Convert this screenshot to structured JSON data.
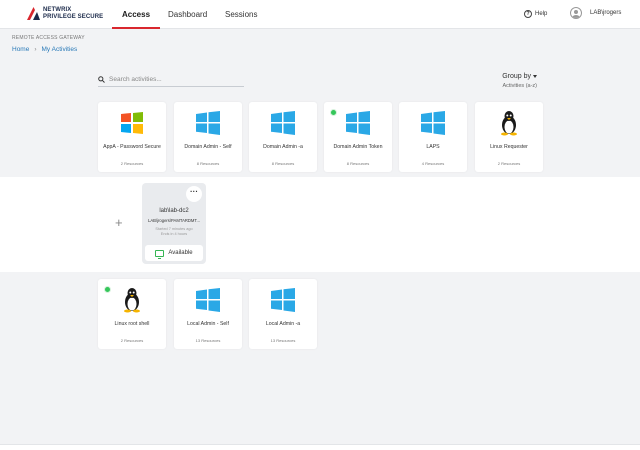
{
  "header": {
    "brand_line1": "NETWRIX",
    "brand_line2": "PRIVILEGE SECURE",
    "tabs": [
      {
        "label": "Access",
        "active": true
      },
      {
        "label": "Dashboard",
        "active": false
      },
      {
        "label": "Sessions",
        "active": false
      }
    ],
    "help_label": "Help",
    "user_label": "LAB\\jrogers"
  },
  "page": {
    "subtitle": "REMOTE ACCESS GATEWAY",
    "breadcrumb": [
      "Home",
      "My Activities"
    ],
    "search_placeholder": "Search activities...",
    "group_by_label": "Group by",
    "group_by_value": "Activities (a-z)"
  },
  "activities_row1": [
    {
      "name": "AppA - Password Secure",
      "resources": "2 Resources",
      "icon": "windows-color-icon",
      "active": false
    },
    {
      "name": "Domain Admin - Self",
      "resources": "8 Resources",
      "icon": "windows-icon",
      "active": false
    },
    {
      "name": "Domain Admin -a",
      "resources": "8 Resources",
      "icon": "windows-icon",
      "active": false
    },
    {
      "name": "Domain Admin Token",
      "resources": "8 Resources",
      "icon": "windows-icon",
      "active": true
    },
    {
      "name": "LAPS",
      "resources": "4 Resources",
      "icon": "windows-icon",
      "active": false
    },
    {
      "name": "Linux Requester",
      "resources": "2 Resources",
      "icon": "linux-tux-icon",
      "active": false
    }
  ],
  "session": {
    "host": "lab\\lab-dc2",
    "account": "LAB\\jrogers\\PAMTARDMT...",
    "started": "Started 7 minutes ago",
    "ends": "Ends in 4 hours",
    "status": "Available",
    "more_label": "···"
  },
  "activities_row2": [
    {
      "name": "Linux root shell",
      "resources": "2 Resources",
      "icon": "linux-tux-icon",
      "active": true
    },
    {
      "name": "Local Admin - Self",
      "resources": "13 Resources",
      "icon": "windows-icon",
      "active": false
    },
    {
      "name": "Local Admin -a",
      "resources": "13 Resources",
      "icon": "windows-icon",
      "active": false
    }
  ],
  "colors": {
    "accent_red": "#d9272e",
    "link_blue": "#2a7ab8",
    "windows_blue": "#2aa8e6",
    "status_green": "#35c65a"
  }
}
